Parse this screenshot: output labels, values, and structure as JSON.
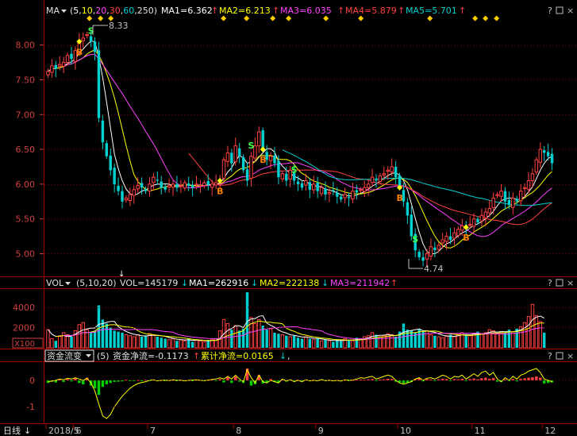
{
  "price_header": {
    "indicator": "MA",
    "params": [
      "5",
      "10",
      "20",
      "30",
      "60",
      "250"
    ],
    "ma1": "MA1=6.362",
    "ma2": "MA2=6.213",
    "ma3": "MA3=6.035",
    "ma4": "MA4=5.879",
    "ma5": "MA5=5.701"
  },
  "volume_header": {
    "indicator": "VOL",
    "params": "(5,10,20)",
    "vol": "VOL=145179",
    "ma1": "MA1=262916",
    "ma2": "MA2=222138",
    "ma3": "MA3=211942"
  },
  "flow_header": {
    "indicator": "资金流变",
    "params": "(5)",
    "net": "资金净流=-0.1173",
    "cum": "累计净流=0.0165"
  },
  "bottom_axis": {
    "period": "日线",
    "labels": [
      "2018/5",
      "6",
      "7",
      "8",
      "9",
      "10",
      "11",
      "12"
    ]
  },
  "colors": {
    "up": "#ff4040",
    "down": "#00d0d0",
    "ma1": "#ffffff",
    "ma2": "#ffff00",
    "ma3": "#ff40ff",
    "ma4": "#ff4040",
    "ma5": "#00d0d0",
    "grid": "#800000"
  },
  "chart_data": [
    {
      "type": "candlestick",
      "yticks": [
        "8.00",
        "7.50",
        "7.00",
        "6.50",
        "6.00",
        "5.50",
        "5.00"
      ],
      "ylim": [
        4.72,
        8.35
      ],
      "annotations": {
        "high": "8.33",
        "low": "4.74"
      },
      "signals": [
        {
          "label": "S",
          "date_index": 11
        },
        {
          "label": "B",
          "date_index": 8
        },
        {
          "label": "B",
          "date_index": 44
        },
        {
          "label": "S",
          "date_index": 52
        },
        {
          "label": "B",
          "date_index": 55
        },
        {
          "label": "S",
          "date_index": 63
        },
        {
          "label": "B",
          "date_index": 90
        },
        {
          "label": "S",
          "date_index": 94
        },
        {
          "label": "B",
          "date_index": 107
        }
      ],
      "close": [
        7.62,
        7.7,
        7.66,
        7.72,
        7.75,
        7.85,
        7.8,
        7.92,
        8.05,
        8.1,
        8.15,
        8.05,
        7.9,
        6.95,
        6.6,
        6.4,
        6.2,
        6.0,
        5.9,
        5.75,
        5.8,
        5.85,
        5.92,
        5.98,
        5.95,
        5.9,
        6.0,
        6.1,
        6.05,
        5.95,
        5.92,
        5.98,
        6.0,
        5.95,
        5.98,
        6.02,
        5.98,
        5.95,
        6.0,
        5.98,
        6.02,
        5.99,
        6.0,
        6.02,
        6.05,
        6.35,
        6.45,
        6.3,
        6.55,
        6.4,
        6.2,
        6.05,
        6.4,
        6.55,
        6.75,
        6.5,
        6.35,
        6.4,
        6.3,
        6.1,
        6.15,
        6.05,
        6.2,
        6.05,
        6.0,
        5.95,
        6.05,
        5.92,
        6.0,
        5.9,
        5.95,
        5.85,
        5.88,
        5.9,
        5.82,
        5.78,
        5.85,
        5.8,
        5.9,
        5.88,
        5.92,
        5.95,
        6.0,
        6.1,
        6.05,
        6.12,
        6.15,
        6.2,
        6.25,
        6.1,
        5.95,
        5.75,
        5.55,
        5.25,
        5.05,
        4.95,
        4.9,
        5.0,
        5.1,
        5.05,
        5.12,
        5.2,
        5.25,
        5.2,
        5.3,
        5.35,
        5.4,
        5.38,
        5.42,
        5.5,
        5.45,
        5.55,
        5.6,
        5.65,
        5.8,
        5.85,
        5.9,
        5.75,
        5.7,
        5.8,
        5.75,
        5.9,
        5.95,
        6.05,
        6.15,
        6.35,
        6.5,
        6.45,
        6.4,
        6.3
      ]
    },
    {
      "type": "bar",
      "yticks": [
        "4000",
        "2000"
      ],
      "unit_box": "X100",
      "ylim": [
        0,
        5500
      ],
      "values": [
        1800,
        900,
        700,
        1200,
        1500,
        1300,
        1100,
        1700,
        2300,
        2500,
        1800,
        1500,
        1700,
        4200,
        2800,
        2400,
        2000,
        1700,
        1600,
        1500,
        1300,
        1200,
        1100,
        1300,
        1100,
        1200,
        1400,
        1300,
        1100,
        1000,
        900,
        800,
        900,
        700,
        800,
        700,
        900,
        600,
        800,
        700,
        600,
        700,
        800,
        900,
        1700,
        2800,
        2400,
        1800,
        2200,
        1700,
        1900,
        5500,
        3000,
        2400,
        2800,
        2200,
        1800,
        1900,
        1500,
        1400,
        1300,
        1200,
        1100,
        1200,
        1000,
        900,
        1100,
        900,
        800,
        900,
        700,
        800,
        700,
        600,
        800,
        700,
        900,
        800,
        700,
        1000,
        900,
        1100,
        1200,
        1500,
        1300,
        1100,
        1200,
        1400,
        1300,
        1100,
        1600,
        2400,
        1800,
        1700,
        1500,
        1900,
        1600,
        1700,
        1300,
        1200,
        1100,
        1000,
        1200,
        1300,
        1100,
        1400,
        1500,
        1300,
        1200,
        1400,
        1600,
        1400,
        1500,
        1800,
        1700,
        1400,
        1600,
        1500,
        1800,
        1600,
        1900,
        2100,
        2500,
        3100,
        4300,
        3200,
        2600,
        1500
      ]
    },
    {
      "type": "bar",
      "yticks": [
        "0",
        "-1"
      ],
      "ylim": [
        -1.6,
        0.6
      ],
      "values": [
        -0.1,
        -0.05,
        -0.08,
        0.03,
        -0.06,
        0.05,
        -0.04,
        0.08,
        -0.1,
        -0.15,
        0.1,
        -0.2,
        -0.3,
        -0.55,
        -0.25,
        -0.15,
        -0.1,
        -0.06,
        -0.05,
        -0.04,
        0.02,
        -0.03,
        -0.02,
        0.01,
        -0.01,
        0.02,
        -0.02,
        0.03,
        -0.01,
        0.01,
        -0.02,
        0.01,
        0.02,
        -0.01,
        0.01,
        -0.02,
        0.01,
        -0.01,
        0.02,
        0.01,
        -0.01,
        0.02,
        0.03,
        -0.02,
        0.05,
        -0.08,
        0.12,
        -0.1,
        0.15,
        -0.05,
        -0.1,
        0.45,
        -0.2,
        -0.15,
        0.2,
        -0.12,
        -0.08,
        0.05,
        -0.06,
        -0.08,
        0.04,
        -0.05,
        0.03,
        -0.03,
        0.02,
        -0.04,
        0.03,
        -0.02,
        0.02,
        -0.01,
        0.03,
        -0.02,
        0.02,
        -0.01,
        0.01,
        -0.02,
        0.02,
        -0.01,
        0.01,
        0.02,
        0.03,
        0.02,
        0.04,
        0.05,
        -0.03,
        0.03,
        0.04,
        0.06,
        0.05,
        -0.05,
        -0.08,
        -0.12,
        -0.1,
        -0.06,
        0.05,
        0.08,
        -0.04,
        0.05,
        0.03,
        -0.02,
        0.04,
        0.06,
        0.05,
        -0.03,
        0.05,
        0.04,
        0.06,
        -0.02,
        0.05,
        0.07,
        0.04,
        0.08,
        0.1,
        0.06,
        0.09,
        -0.05,
        -0.06,
        0.04,
        -0.03,
        0.05,
        -0.04,
        0.06,
        0.08,
        0.1,
        0.12,
        0.15,
        0.1,
        -0.12,
        -0.1,
        -0.08
      ],
      "line": [
        -0.05,
        -0.03,
        0.0,
        0.05,
        0.02,
        0.08,
        0.05,
        0.1,
        0.05,
        0.0,
        0.08,
        -0.1,
        -0.4,
        -0.9,
        -1.35,
        -1.45,
        -1.3,
        -1.0,
        -0.8,
        -0.6,
        -0.45,
        -0.3,
        -0.2,
        -0.12,
        -0.08,
        -0.05,
        0.0,
        0.02,
        -0.02,
        0.0,
        0.01,
        -0.01,
        0.02,
        0.0,
        0.01,
        -0.02,
        0.0,
        0.01,
        0.02,
        0.0,
        -0.01,
        0.01,
        0.03,
        0.05,
        0.1,
        0.05,
        0.15,
        0.05,
        0.2,
        0.05,
        -0.05,
        0.4,
        0.1,
        -0.1,
        0.2,
        -0.05,
        -0.1,
        0.0,
        -0.05,
        -0.1,
        0.05,
        -0.02,
        0.02,
        -0.05,
        0.0,
        -0.05,
        0.02,
        -0.02,
        0.0,
        -0.02,
        0.03,
        -0.01,
        0.0,
        -0.02,
        0.0,
        -0.03,
        0.02,
        0.0,
        0.01,
        0.05,
        0.1,
        0.08,
        0.12,
        0.15,
        0.05,
        0.1,
        0.15,
        0.2,
        0.15,
        0.0,
        -0.1,
        -0.15,
        -0.1,
        -0.05,
        0.05,
        0.1,
        0.0,
        0.08,
        0.1,
        0.05,
        0.12,
        0.2,
        0.15,
        0.05,
        0.15,
        0.12,
        0.2,
        0.05,
        0.15,
        0.25,
        0.15,
        0.3,
        0.35,
        0.2,
        0.3,
        0.05,
        -0.05,
        0.1,
        0.0,
        0.15,
        0.05,
        0.2,
        0.25,
        0.35,
        0.4,
        0.45,
        0.3,
        0.05,
        0.0,
        -0.05
      ]
    }
  ]
}
